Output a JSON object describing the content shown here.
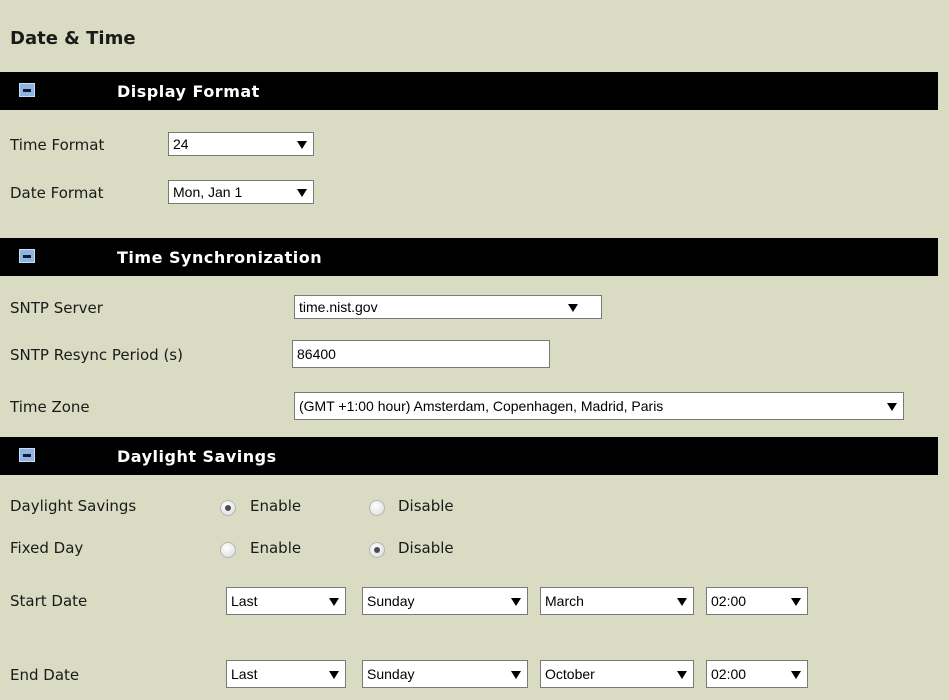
{
  "page_title": "Date & Time",
  "sections": {
    "display_format": {
      "title": "Display Format",
      "time_format": {
        "label": "Time Format",
        "value": "24"
      },
      "date_format": {
        "label": "Date Format",
        "value": "Mon, Jan 1"
      }
    },
    "time_sync": {
      "title": "Time Synchronization",
      "sntp_server": {
        "label": "SNTP Server",
        "value": "time.nist.gov"
      },
      "resync_period": {
        "label": "SNTP Resync Period (s)",
        "value": "86400"
      },
      "time_zone": {
        "label": "Time Zone",
        "value": "(GMT +1:00 hour) Amsterdam, Copenhagen, Madrid, Paris"
      }
    },
    "daylight": {
      "title": "Daylight Savings",
      "daylight_savings": {
        "label": "Daylight Savings",
        "enable": "Enable",
        "disable": "Disable",
        "selected": "enable"
      },
      "fixed_day": {
        "label": "Fixed Day",
        "enable": "Enable",
        "disable": "Disable",
        "selected": "disable"
      },
      "start_date": {
        "label": "Start Date",
        "week": "Last",
        "day": "Sunday",
        "month": "March",
        "time": "02:00"
      },
      "end_date": {
        "label": "End Date",
        "week": "Last",
        "day": "Sunday",
        "month": "October",
        "time": "02:00"
      }
    }
  },
  "colors": {
    "background": "#d9dcc2",
    "header": "#000000",
    "header_text": "#ffffff",
    "icon": "#8fb4e0"
  }
}
